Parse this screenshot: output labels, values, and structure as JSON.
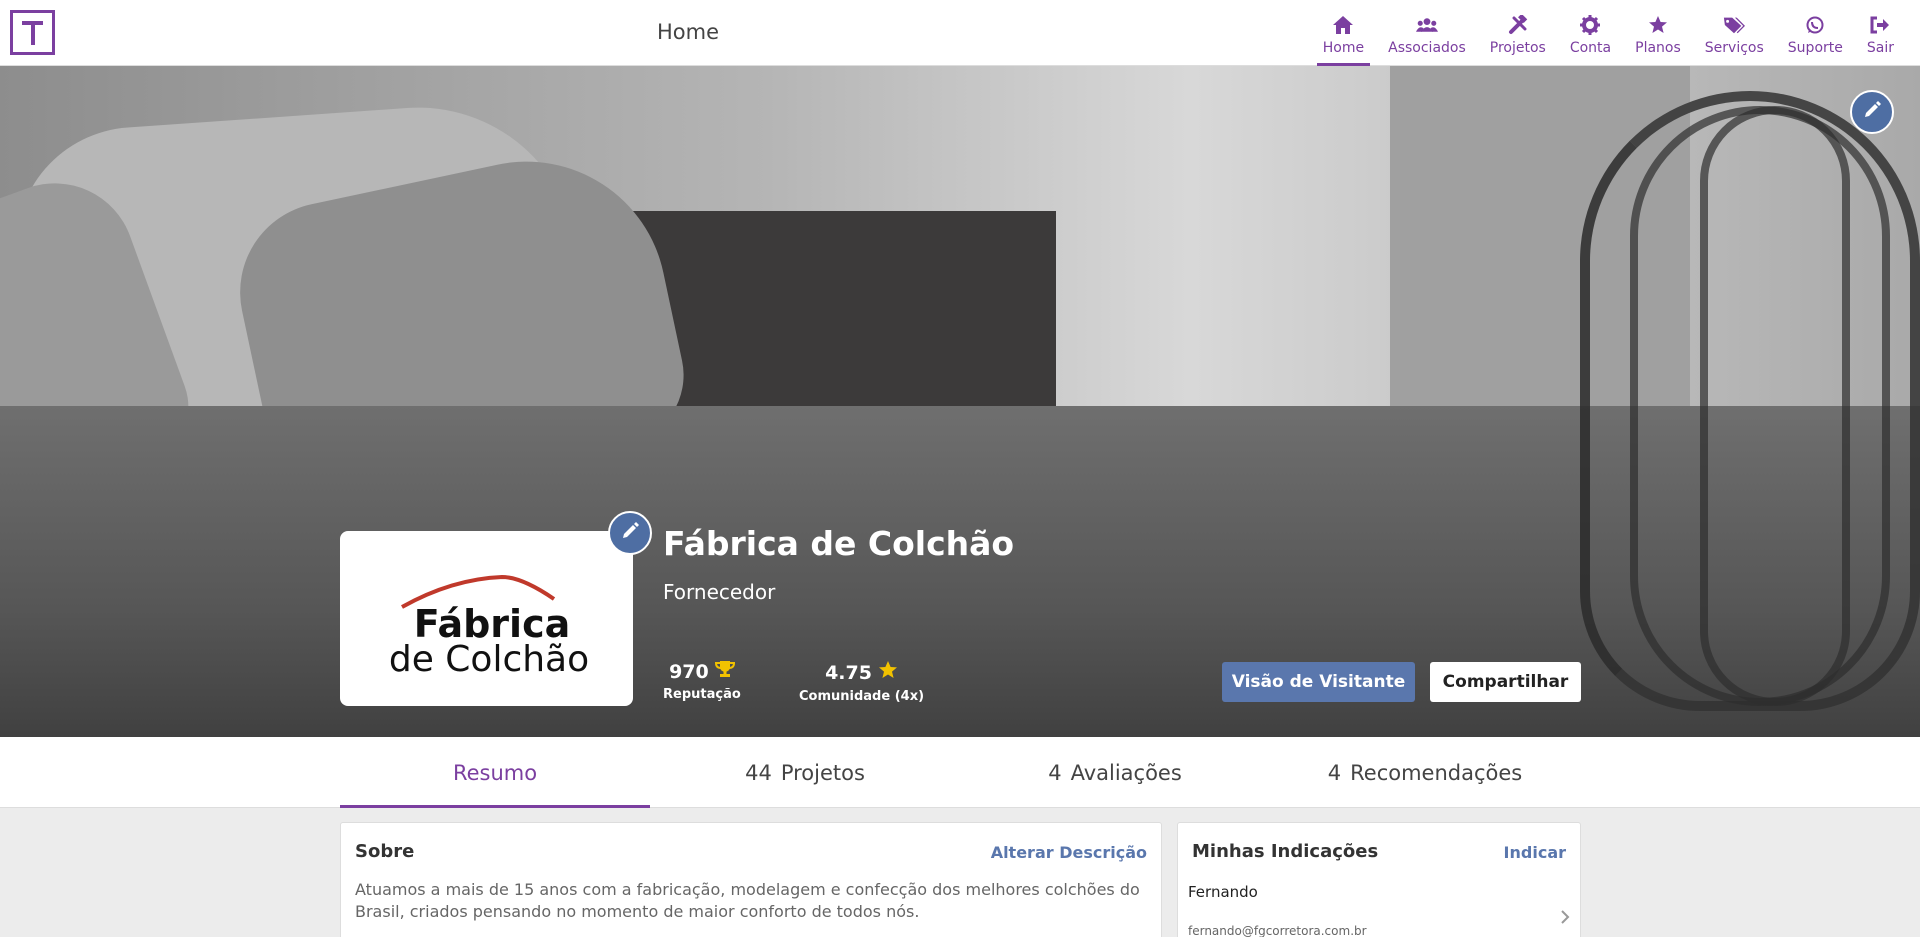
{
  "app": {
    "logo_letter": "T",
    "page_title": "Home",
    "accent": "#7b3fa0",
    "blue": "#5a77ad"
  },
  "nav": [
    {
      "label": "Home",
      "icon": "home-icon",
      "active": true
    },
    {
      "label": "Associados",
      "icon": "users-icon"
    },
    {
      "label": "Projetos",
      "icon": "tools-icon"
    },
    {
      "label": "Conta",
      "icon": "gear-icon"
    },
    {
      "label": "Planos",
      "icon": "star-icon"
    },
    {
      "label": "Serviços",
      "icon": "tags-icon"
    },
    {
      "label": "Suporte",
      "icon": "whatsapp-icon"
    },
    {
      "label": "Sair",
      "icon": "sign-out-icon"
    }
  ],
  "profile": {
    "logo_line1": "Fábrica",
    "logo_line2": "de Colchão",
    "name": "Fábrica de Colchão",
    "type": "Fornecedor",
    "reputation_value": "970",
    "reputation_label": "Reputação",
    "community_value": "4.75",
    "community_label": "Comunidade (4x)",
    "visitor_button": "Visão de Visitante",
    "share_button": "Compartilhar"
  },
  "tabs": [
    {
      "count": "",
      "label": "Resumo",
      "active": true
    },
    {
      "count": "44",
      "label": "Projetos"
    },
    {
      "count": "4",
      "label": "Avaliações"
    },
    {
      "count": "4",
      "label": "Recomendações"
    }
  ],
  "about": {
    "title": "Sobre",
    "action": "Alterar Descrição",
    "text": "Atuamos a mais de 15 anos com a fabricação, modelagem e confecção dos melhores colchões do Brasil, criados pensando no momento de maior conforto de todos nós."
  },
  "indications": {
    "title": "Minhas Indicações",
    "action": "Indicar",
    "items": [
      {
        "name": "Fernando",
        "email": "fernando@fgcorretora.com.br"
      }
    ]
  }
}
